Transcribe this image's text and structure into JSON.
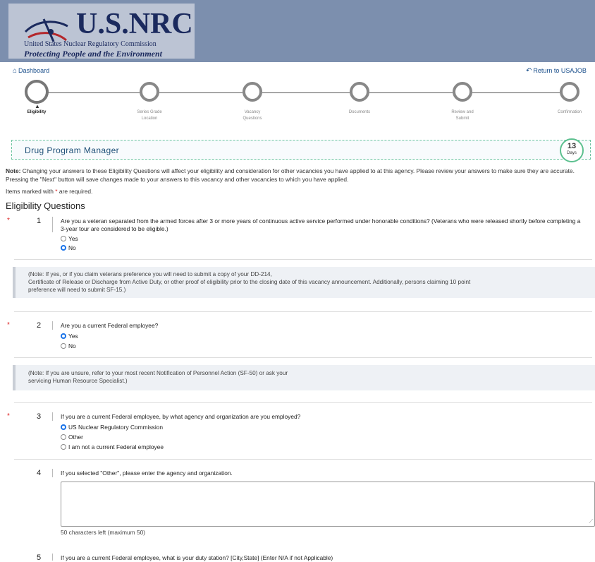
{
  "banner": {
    "logo_title": "U.S.NRC",
    "logo_subtitle": "United States Nuclear Regulatory Commission",
    "logo_tagline": "Protecting People and the Environment"
  },
  "nav": {
    "dashboard": "Dashboard",
    "return": "Return to USAJOB"
  },
  "steps": [
    {
      "label": "Eligibility",
      "active": true
    },
    {
      "label": "Series Grade\nLocation",
      "active": false
    },
    {
      "label": "Vacancy\nQuestions",
      "active": false
    },
    {
      "label": "Documents",
      "active": false
    },
    {
      "label": "Review and\nSubmit",
      "active": false
    },
    {
      "label": "Confirmation",
      "active": false
    }
  ],
  "vacancy": {
    "title": "Drug Program Manager",
    "days_number": "13",
    "days_label": "Days"
  },
  "note": {
    "label": "Note:",
    "text": "Changing your answers to these Eligibility Questions will affect your eligibility and consideration for other vacancies you have applied to at this agency. Please review your answers to make sure they are accurate. Pressing the \"Next\" button will save changes made to your answers to this vacancy and other vacancies to which you have applied."
  },
  "required_note": {
    "before": "Items marked with ",
    "star": "*",
    "after": " are required."
  },
  "section_title": "Eligibility Questions",
  "questions": [
    {
      "number": "1",
      "required": true,
      "text": "Are you a veteran separated from the armed forces after 3 or more years of continuous active service performed under honorable conditions? (Veterans who were released shortly before completing a 3-year tour are considered to be eligible.)",
      "options": [
        "Yes",
        "No"
      ],
      "selected": "No",
      "note": "(Note: If yes, or if you claim veterans preference you will need to submit a copy of your DD-214, Certificate of Release or Discharge from Active Duty, or other proof of eligibility prior to the closing date of this vacancy announcement. Additionally, persons claiming 10 point preference will need to submit SF-15.)",
      "note_line1": "(Note: If yes, or if you claim veterans preference you will need to submit a copy of your DD-214,",
      "note_line2": "Certificate of Release or Discharge from Active Duty, or other proof of eligibility prior to the closing date of this vacancy announcement. Additionally, persons claiming 10 point",
      "note_line3": "preference will need to submit SF-15.)"
    },
    {
      "number": "2",
      "required": true,
      "text": "Are you a current Federal employee?",
      "options": [
        "Yes",
        "No"
      ],
      "selected": "Yes",
      "note_line1": "(Note: If you are unsure, refer to your most recent Notification of Personnel Action (SF-50) or ask your",
      "note_line2": "servicing Human Resource Specialist.)"
    },
    {
      "number": "3",
      "required": true,
      "text": "If you are a current Federal employee, by what agency and organization are you employed?",
      "options": [
        "US Nuclear Regulatory Commission",
        "Other",
        "I am not a current Federal employee"
      ],
      "selected": "US Nuclear Regulatory Commission"
    },
    {
      "number": "4",
      "required": false,
      "text": "If you selected \"Other\", please enter the agency and organization.",
      "textarea_value": "",
      "chars_left": "50 characters left (maximum 50)"
    },
    {
      "number": "5",
      "required": false,
      "text": "If you are a current Federal employee, what is your duty station? [City,State] (Enter N/A if not Applicable)"
    }
  ],
  "colors": {
    "banner": "#7c8fae",
    "accent_green": "#5cc08f",
    "required_star": "#dd2222",
    "radio_selected": "#1a73e8"
  },
  "icons": {
    "dashboard": "home-icon",
    "return": "reply-arrow-icon"
  }
}
